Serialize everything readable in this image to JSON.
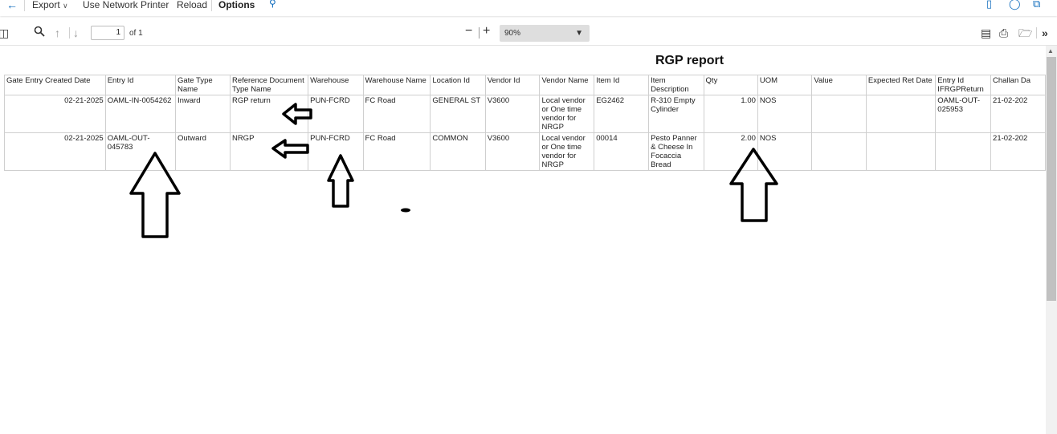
{
  "command_bar": {
    "export_label": "Export",
    "network_printer_label": "Use Network Printer",
    "reload_label": "Reload",
    "options_label": "Options"
  },
  "viewer_toolbar": {
    "page_number": "1",
    "page_of": "of 1",
    "zoom_value": "90%"
  },
  "report": {
    "title": "RGP report",
    "columns": [
      "Gate Entry Created Date",
      "Entry Id",
      "Gate Type Name",
      "Reference Document Type Name",
      "Warehouse",
      "Warehouse Name",
      "Location Id",
      "Vendor Id",
      "Vendor Name",
      "Item Id",
      "Item Description",
      "Qty",
      "UOM",
      "Value",
      "Expected Ret Date",
      "Entry Id IFRGPReturn",
      "Challan Da"
    ],
    "rows": [
      [
        "02-21-2025",
        "OAML-IN-0054262",
        "Inward",
        "RGP return",
        "PUN-FCRD",
        "FC Road",
        "GENERAL ST",
        "V3600",
        "Local vendor or One time vendor for NRGP",
        "EG2462",
        "R-310 Empty Cylinder",
        "1.00",
        "NOS",
        "",
        "",
        "OAML-OUT-025953",
        "21-02-202"
      ],
      [
        "02-21-2025",
        "OAML-OUT-045783",
        "Outward",
        "NRGP",
        "PUN-FCRD",
        "FC Road",
        "COMMON",
        "V3600",
        "Local vendor or One time vendor for NRGP",
        "00014",
        "Pesto Panner & Cheese In Focaccia Bread",
        "2.00",
        "NOS",
        "",
        "",
        "",
        "21-02-202"
      ]
    ]
  },
  "colors": {
    "accent": "#0f6cbd",
    "grid_border": "#cfcfcf",
    "zoom_bg": "#dedede",
    "annotation": "#000000"
  },
  "icons": {
    "back": "back-arrow-icon",
    "export_chevron": "chevron-down-icon",
    "find": "find-icon",
    "sidebar": "sidebar-toggle-icon",
    "search": "search-icon",
    "prev": "arrow-up-icon",
    "next": "arrow-down-icon",
    "zoom_out": "minus-icon",
    "zoom_in": "plus-icon",
    "print": "print-icon",
    "save": "save-icon",
    "more": "more-chevrons-icon"
  }
}
